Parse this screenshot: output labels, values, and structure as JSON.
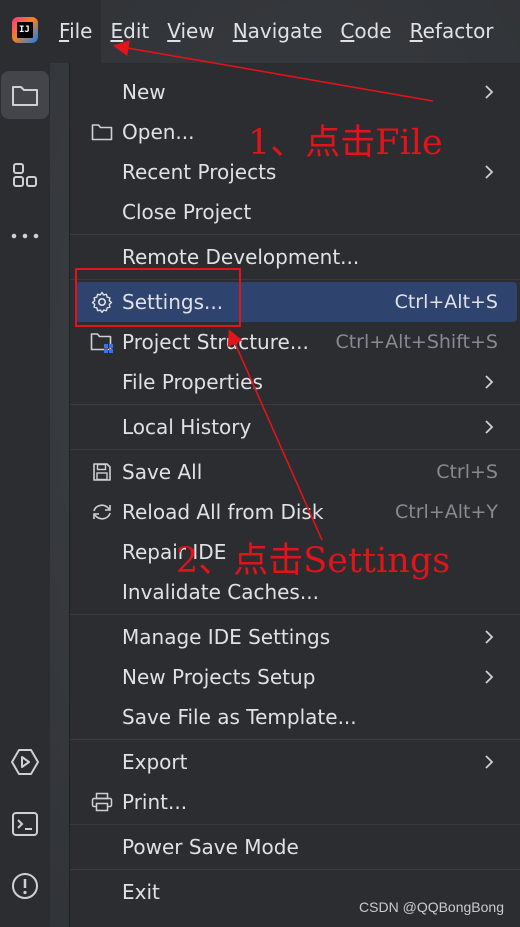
{
  "menubar": {
    "items": [
      {
        "label": "File",
        "mnemonic": "F",
        "rest": "ile"
      },
      {
        "label": "Edit",
        "mnemonic": "E",
        "rest": "dit"
      },
      {
        "label": "View",
        "mnemonic": "V",
        "rest": "iew"
      },
      {
        "label": "Navigate",
        "mnemonic": "N",
        "rest": "avigate"
      },
      {
        "label": "Code",
        "mnemonic": "C",
        "rest": "ode"
      },
      {
        "label": "Refactor",
        "mnemonic": "R",
        "rest": "efactor"
      }
    ]
  },
  "file_menu": {
    "new": "New",
    "open": "Open...",
    "recent_projects": "Recent Projects",
    "close_project": "Close Project",
    "remote_development": "Remote Development...",
    "settings": "Settings...",
    "settings_shortcut": "Ctrl+Alt+S",
    "project_structure": "Project Structure...",
    "project_structure_shortcut": "Ctrl+Alt+Shift+S",
    "file_properties": "File Properties",
    "local_history": "Local History",
    "save_all": "Save All",
    "save_all_shortcut": "Ctrl+S",
    "reload_all": "Reload All from Disk",
    "reload_all_shortcut": "Ctrl+Alt+Y",
    "repair_ide": "Repair IDE",
    "invalidate_caches": "Invalidate Caches...",
    "manage_ide_settings": "Manage IDE Settings",
    "new_projects_setup": "New Projects Setup",
    "save_file_as_template": "Save File as Template...",
    "export": "Export",
    "print": "Print...",
    "power_save_mode": "Power Save Mode",
    "exit": "Exit"
  },
  "annotations": {
    "step1": "1、点击File",
    "step2": "2、点击Settings",
    "color": "#e0141a"
  },
  "watermark": "CSDN @QQBongBong",
  "colors": {
    "menu_bg": "#2b2d30",
    "selection": "#2e436e",
    "text": "#dfe1e5",
    "shortcut_text": "#868a91"
  },
  "icons": [
    "app-logo-icon",
    "folder-icon",
    "structure-icon",
    "more-icon",
    "services-icon",
    "terminal-icon",
    "problems-icon"
  ]
}
